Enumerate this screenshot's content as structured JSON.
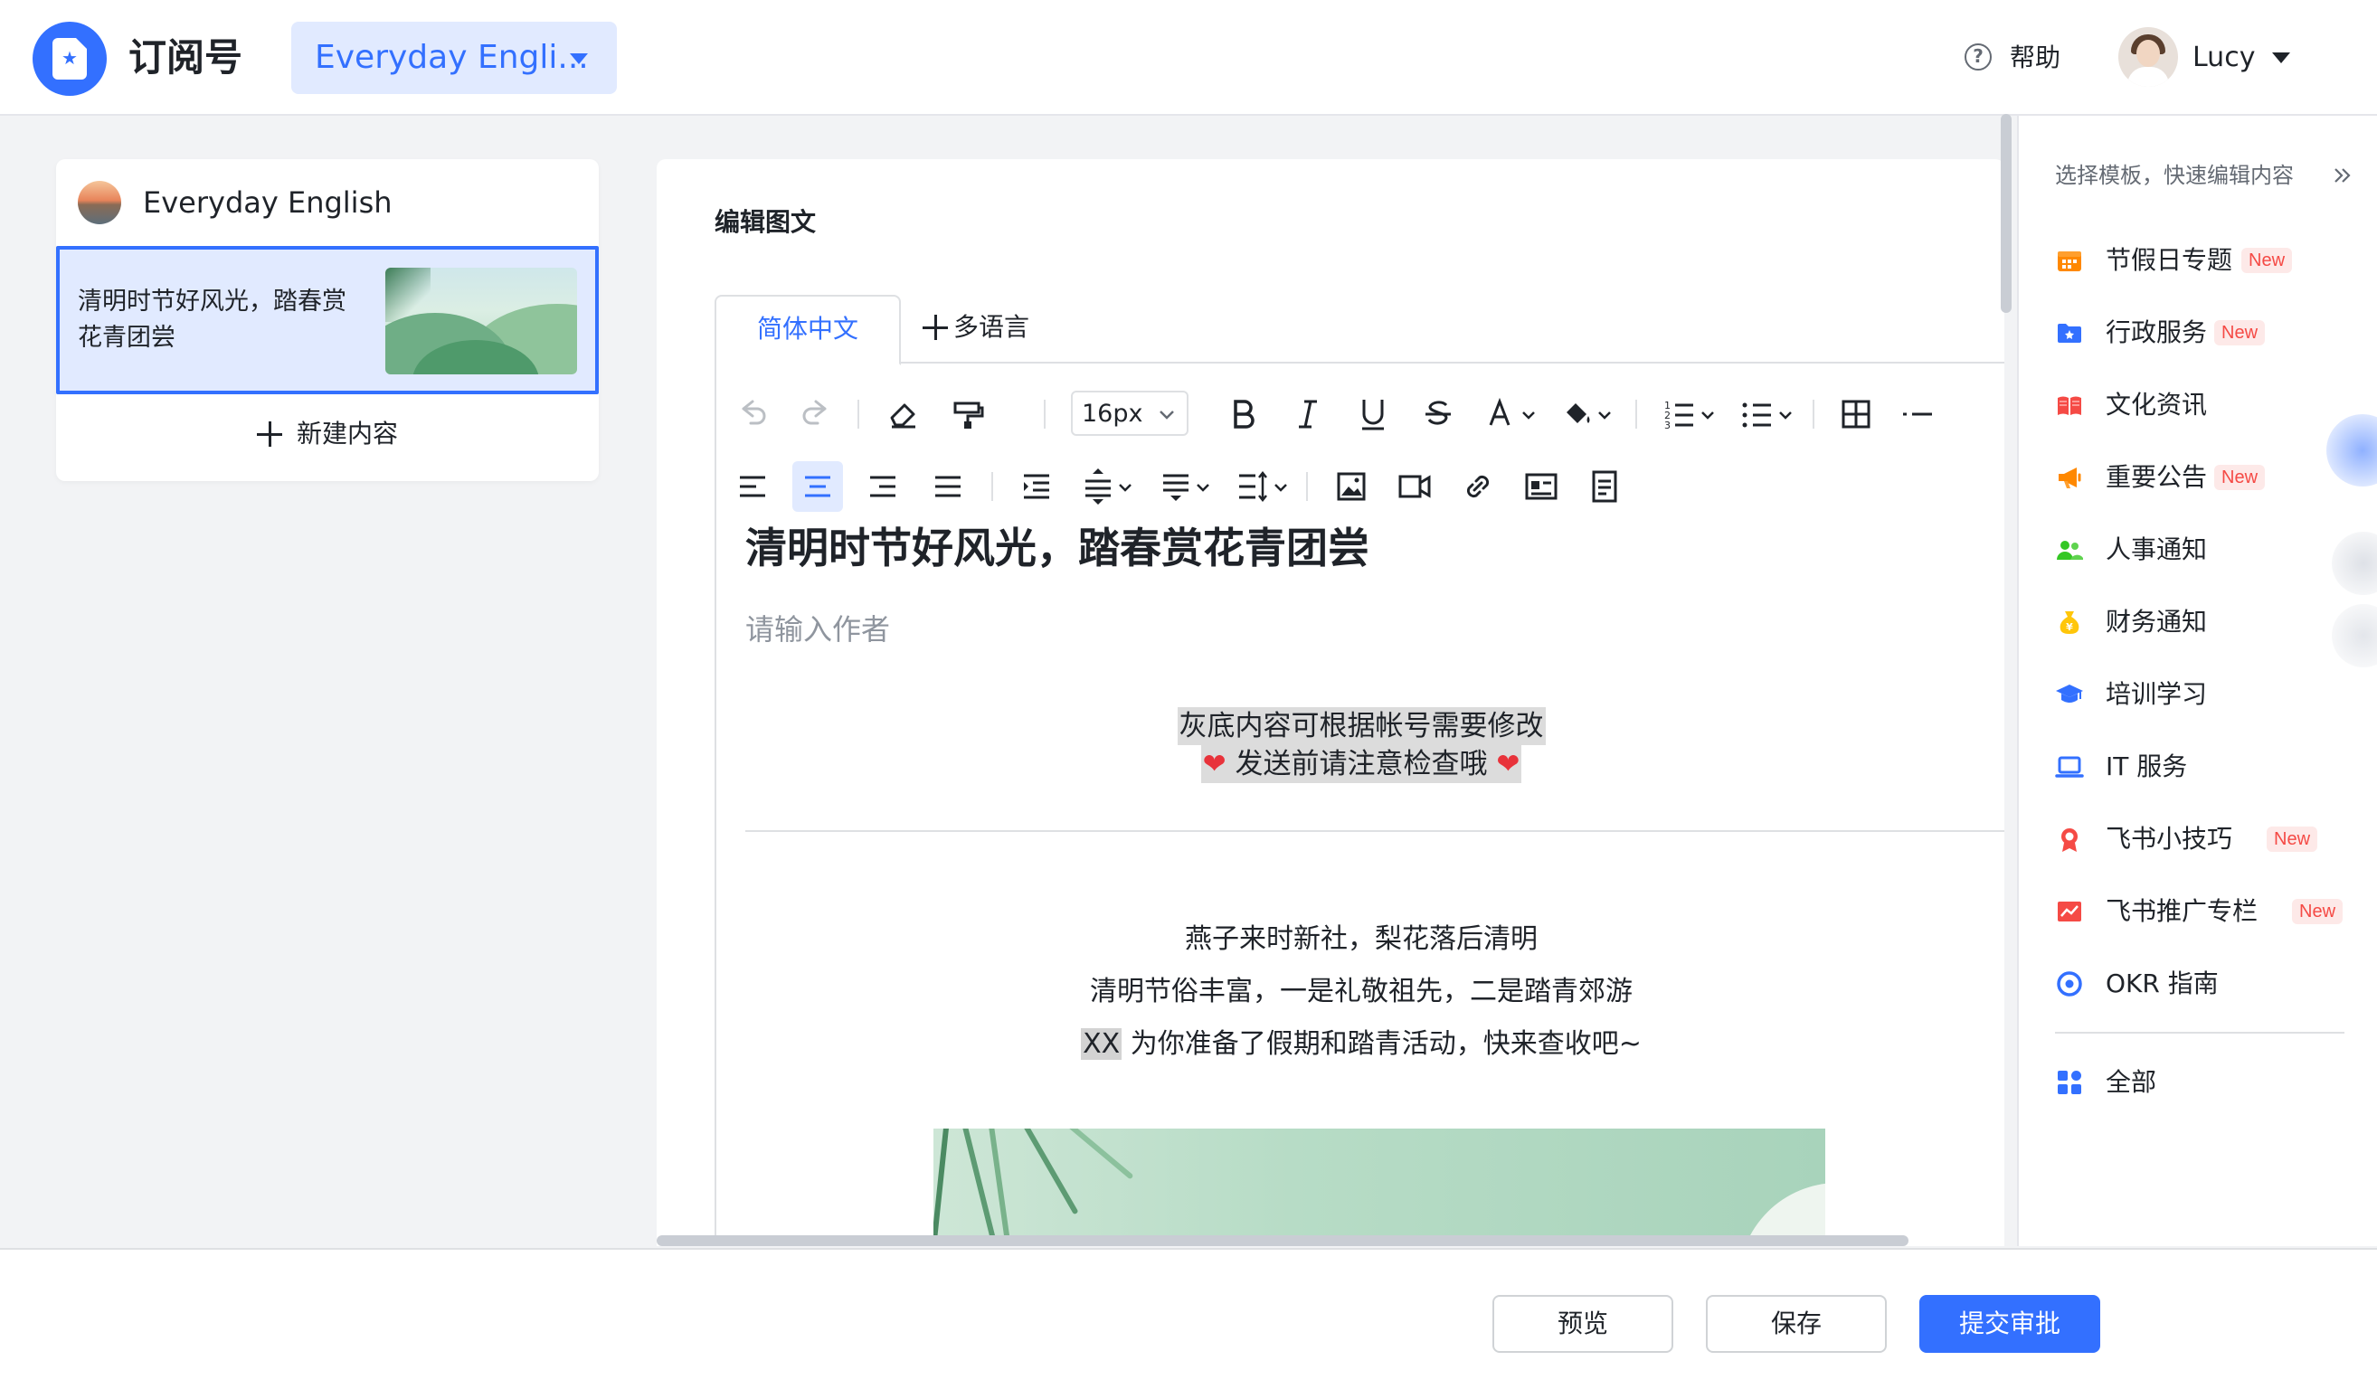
{
  "header": {
    "app_title": "订阅号",
    "account_selector": "Everyday Engli...",
    "help": "帮助",
    "user_name": "Lucy"
  },
  "left_panel": {
    "account_name": "Everyday English",
    "content_items": [
      {
        "title": "清明时节好风光，踏春赏花青团尝"
      }
    ],
    "new_content": "新建内容"
  },
  "editor": {
    "section_title": "编辑图文",
    "tabs": [
      {
        "label": "简体中文",
        "active": true
      }
    ],
    "add_language": "多语言",
    "font_size": "16px",
    "doc_title": "清明时节好风光，踏春赏花青团尝",
    "author_placeholder": "请输入作者",
    "gray_notice_1": "灰底内容可根据帐号需要修改",
    "gray_notice_2": "发送前请注意检查哦",
    "heart_glyph": "❤",
    "poem_line_1": "燕子来时新社，梨花落后清明",
    "poem_line_2": "清明节俗丰富，一是礼敬祖先，二是踏青郊游",
    "poem_line_3_highlight": "XX",
    "poem_line_3_rest": " 为你准备了假期和踏青活动，快来查收吧~"
  },
  "templates_panel": {
    "hint": "选择模板，快速编辑内容",
    "new_badge": "New",
    "items": [
      {
        "label": "节假日专题",
        "is_new": true,
        "icon": "calendar-icon",
        "color": "#ff8800"
      },
      {
        "label": "行政服务",
        "is_new": true,
        "icon": "folder-icon",
        "color": "#3370ff"
      },
      {
        "label": "文化资讯",
        "is_new": false,
        "icon": "book-icon",
        "color": "#f54a45"
      },
      {
        "label": "重要公告",
        "is_new": true,
        "icon": "megaphone-icon",
        "color": "#ff8800"
      },
      {
        "label": "人事通知",
        "is_new": false,
        "icon": "people-icon",
        "color": "#34c724"
      },
      {
        "label": "财务通知",
        "is_new": false,
        "icon": "money-bag-icon",
        "color": "#ffc60a"
      },
      {
        "label": "培训学习",
        "is_new": false,
        "icon": "graduation-cap-icon",
        "color": "#3370ff"
      },
      {
        "label": "IT 服务",
        "is_new": false,
        "icon": "laptop-icon",
        "color": "#3370ff"
      },
      {
        "label": "飞书小技巧",
        "is_new": true,
        "icon": "medal-icon",
        "color": "#f54a45"
      },
      {
        "label": "飞书推广专栏",
        "is_new": true,
        "icon": "chart-icon",
        "color": "#f54a45"
      },
      {
        "label": "OKR 指南",
        "is_new": false,
        "icon": "target-icon",
        "color": "#3370ff"
      }
    ],
    "all_label": "全部"
  },
  "footer": {
    "preview": "预览",
    "save": "保存",
    "submit": "提交审批"
  },
  "colors": {
    "accent": "#3370ff",
    "accent_light": "#e1eaff",
    "new_badge_text": "#f54a45",
    "new_badge_bg": "#fde9e8"
  }
}
